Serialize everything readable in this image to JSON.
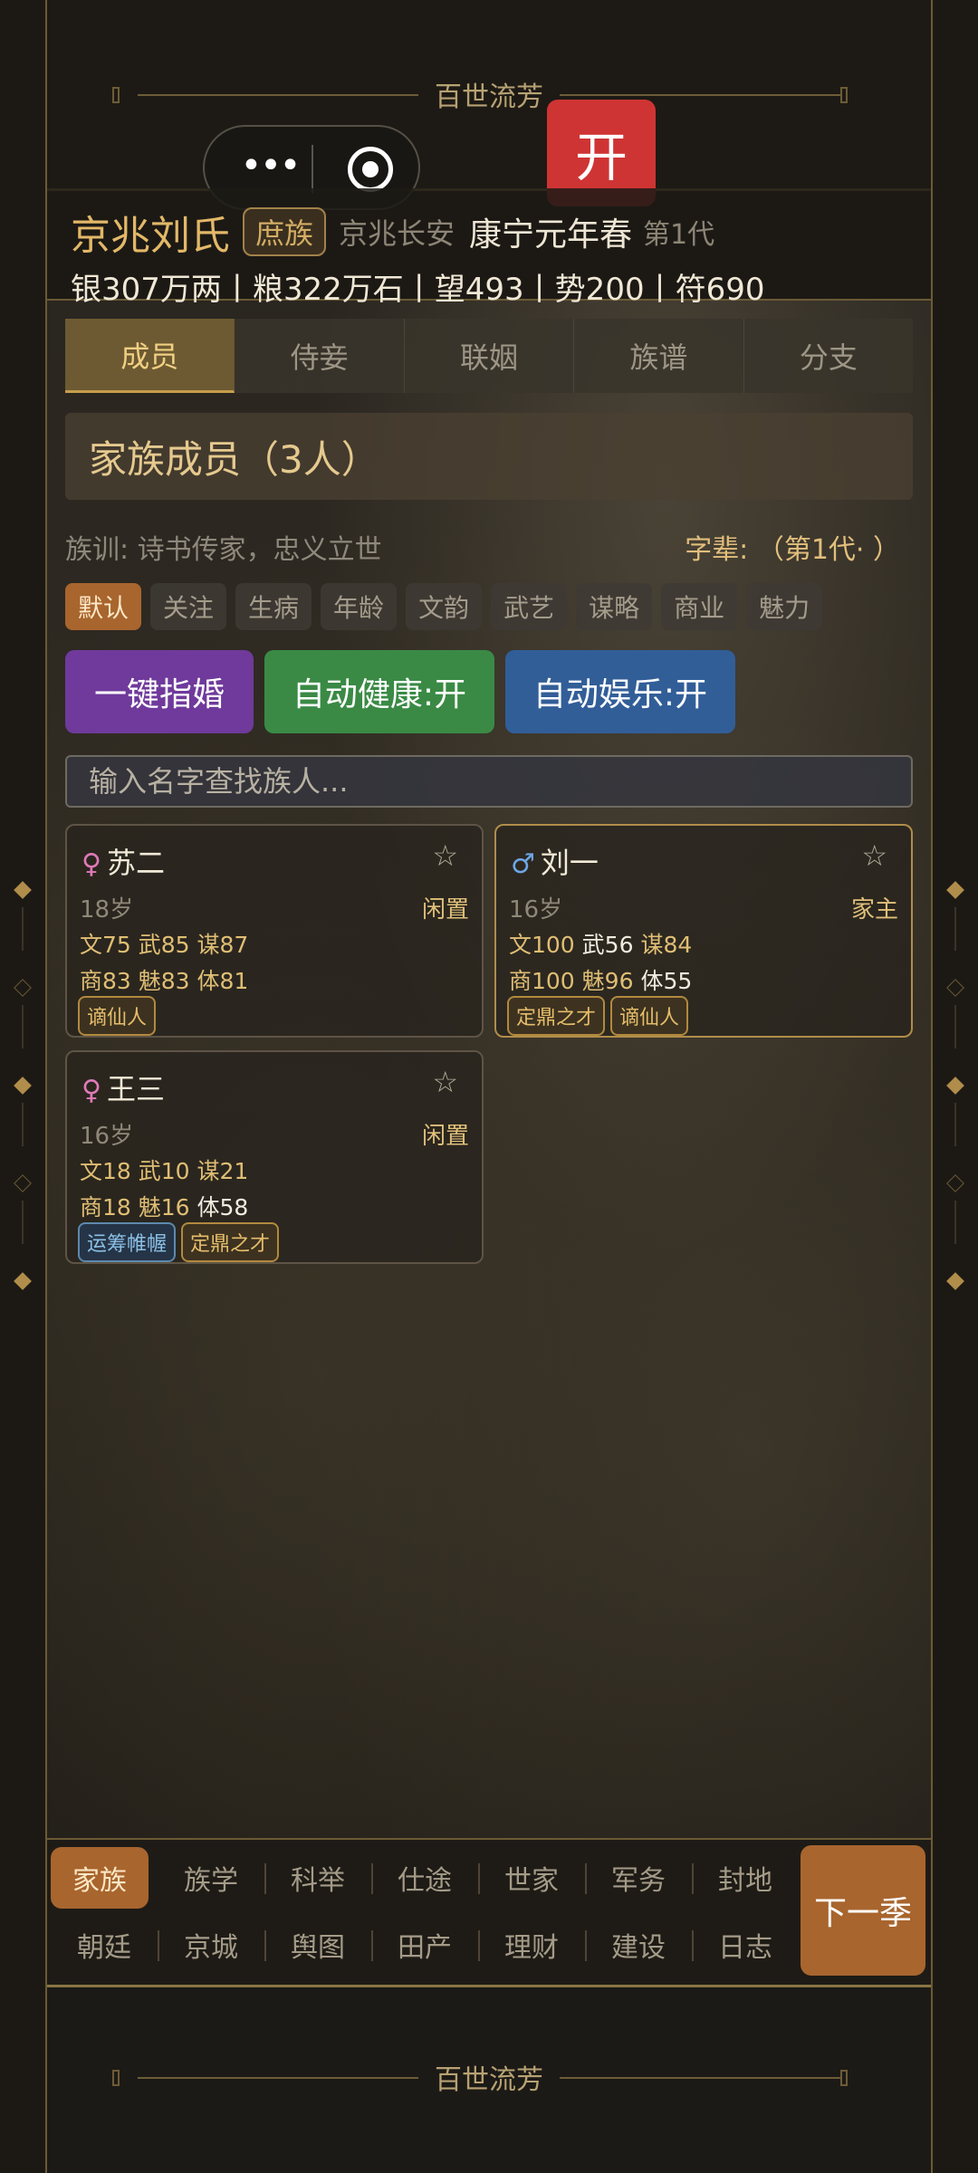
{
  "app": {
    "banner_title": "百世流芳",
    "open_label": "开",
    "capsule_more": "•••"
  },
  "clan": {
    "name": "京兆刘氏",
    "rank": "庶族",
    "location": "京兆长安",
    "era": "康宁元年春",
    "generation": "第1代",
    "resources": "银307万两丨粮322万石丨望493丨势200丨符690"
  },
  "tabs": [
    "成员",
    "侍妾",
    "联姻",
    "族谱",
    "分支"
  ],
  "panel": {
    "title": "家族成员（3人）",
    "motto": "族训: 诗书传家，忠义立世",
    "zibei": "字辈: （第1代· ）"
  },
  "filters": [
    "默认",
    "关注",
    "生病",
    "年龄",
    "文韵",
    "武艺",
    "谋略",
    "商业",
    "魅力"
  ],
  "actions": {
    "match": "一键指婚",
    "health": "自动健康:开",
    "fun": "自动娱乐:开",
    "colors": {
      "match": "#6f3a9b",
      "health": "#3a8a45",
      "fun": "#325e98"
    }
  },
  "search": {
    "placeholder": "输入名字查找族人..."
  },
  "members": [
    {
      "sex": "♀",
      "name": "苏二",
      "star": "☆",
      "age": "18岁",
      "status": "闲置",
      "wen": "文75",
      "wu": "武85",
      "mou": "谋87",
      "shang": "商83",
      "mei": "魅83",
      "ti": "体81",
      "tags": [
        "谪仙人"
      ]
    },
    {
      "sex": "♂",
      "name": "刘一",
      "star": "☆",
      "age": "16岁",
      "status": "家主",
      "wen": "文100",
      "wu": "武56",
      "mou": "谋84",
      "shang": "商100",
      "mei": "魅96",
      "ti": "体55",
      "tags": [
        "定鼎之才",
        "谪仙人"
      ]
    },
    {
      "sex": "♀",
      "name": "王三",
      "star": "☆",
      "age": "16岁",
      "status": "闲置",
      "wen": "文18",
      "wu": "武10",
      "mou": "谋21",
      "shang": "商18",
      "mei": "魅16",
      "ti": "体58",
      "tags": [
        "运筹帷幄",
        "定鼎之才"
      ]
    }
  ],
  "bottom_nav": {
    "row1": [
      "家族",
      "族学",
      "科举",
      "仕途",
      "世家",
      "军务",
      "封地"
    ],
    "row2": [
      "朝廷",
      "京城",
      "舆图",
      "田产",
      "理财",
      "建设",
      "日志"
    ],
    "next": "下一季"
  }
}
